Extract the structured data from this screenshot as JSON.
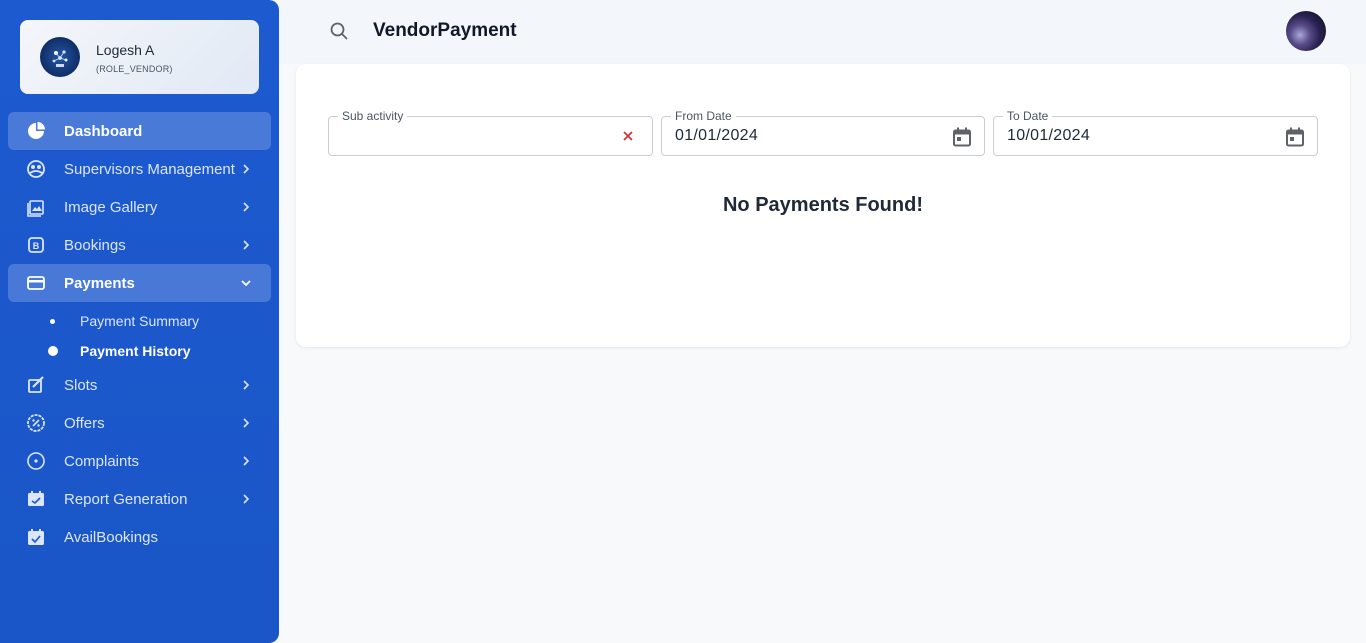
{
  "user": {
    "name": "Logesh A",
    "role": "(ROLE_VENDOR)",
    "avatar_icon": "vendor-logo-icon"
  },
  "sidebar": {
    "items": [
      {
        "label": "Dashboard",
        "icon": "pie-chart-icon",
        "state": "active"
      },
      {
        "label": "Supervisors Management",
        "icon": "supervisors-icon",
        "has_chevron": true
      },
      {
        "label": "Image Gallery",
        "icon": "image-gallery-icon",
        "has_chevron": true
      },
      {
        "label": "Bookings",
        "icon": "bookings-icon",
        "has_chevron": true
      },
      {
        "label": "Payments",
        "icon": "credit-card-icon",
        "state": "expanded"
      },
      {
        "label": "Slots",
        "icon": "slots-icon",
        "has_chevron": true
      },
      {
        "label": "Offers",
        "icon": "offers-icon",
        "has_chevron": true
      },
      {
        "label": "Complaints",
        "icon": "complaints-icon",
        "has_chevron": true
      },
      {
        "label": "Report Generation",
        "icon": "report-icon",
        "has_chevron": true
      },
      {
        "label": "AvailBookings",
        "icon": "calendar-check-icon",
        "has_chevron": false
      }
    ],
    "payments_sub": [
      {
        "label": "Payment Summary"
      },
      {
        "label": "Payment History",
        "current": true
      }
    ]
  },
  "header": {
    "title": "VendorPayment",
    "search_icon": "search-icon"
  },
  "filters": {
    "sub_activity": {
      "label": "Sub activity",
      "value": ""
    },
    "from_date": {
      "label": "From Date",
      "value": "01/01/2024"
    },
    "to_date": {
      "label": "To Date",
      "value": "10/01/2024"
    }
  },
  "empty_message": "No Payments Found!",
  "colors": {
    "sidebar": "#1a56c7",
    "clear_icon": "#d32f2f",
    "calendar_icon": "#5f6368"
  }
}
